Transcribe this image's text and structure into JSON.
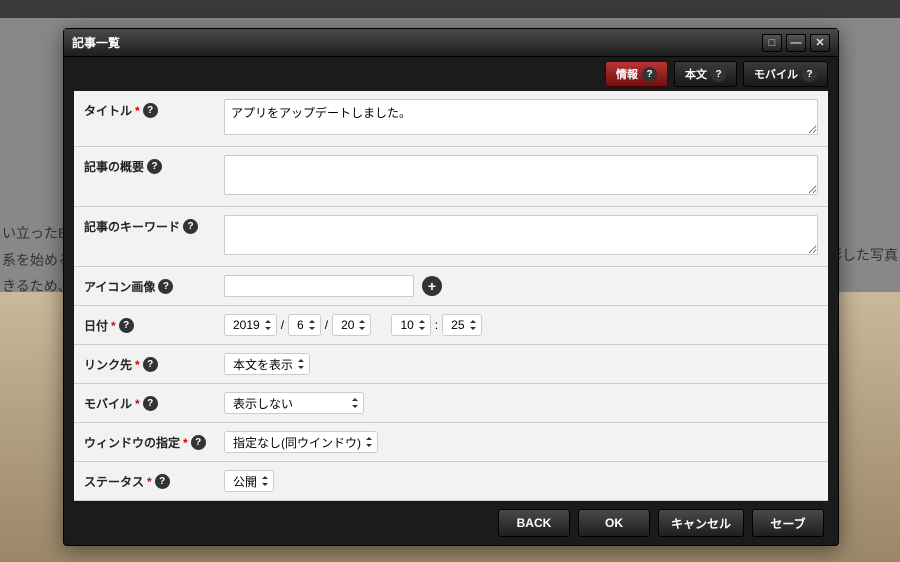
{
  "background": {
    "line1": "い立ったE",
    "line2": "系を始めるi",
    "line3": "きるため、",
    "right": "彫した写真"
  },
  "window": {
    "title": "記事一覧"
  },
  "tabs": {
    "info": "情報",
    "body": "本文",
    "mobile": "モバイル"
  },
  "labels": {
    "title": "タイトル",
    "summary": "記事の概要",
    "keywords": "記事のキーワード",
    "icon": "アイコン画像",
    "date": "日付",
    "link": "リンク先",
    "mobile": "モバイル",
    "windowTarget": "ウィンドウの指定",
    "status": "ステータス"
  },
  "values": {
    "title": "アプリをアップデートしました。",
    "summary": "",
    "keywords": "",
    "iconPath": "",
    "year": "2019",
    "month": "6",
    "day": "20",
    "hour": "10",
    "minute": "25",
    "link": "本文を表示",
    "mobile": "表示しない",
    "windowTarget": "指定なし(同ウインドウ)",
    "status": "公開"
  },
  "buttons": {
    "back": "BACK",
    "ok": "OK",
    "cancel": "キャンセル",
    "save": "セーブ"
  },
  "sep": {
    "slash": "/",
    "colon": ":",
    "asterisk": "*"
  }
}
